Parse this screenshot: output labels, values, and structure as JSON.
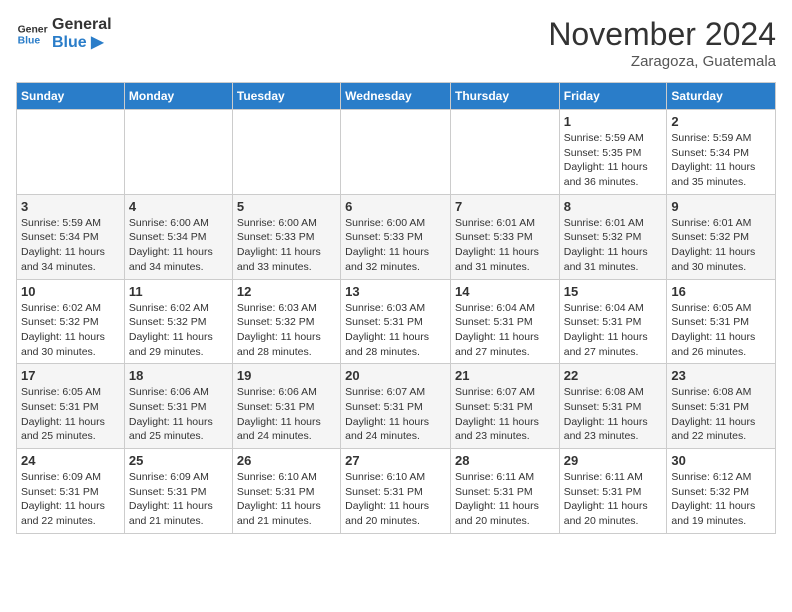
{
  "header": {
    "logo_line1": "General",
    "logo_line2": "Blue",
    "month": "November 2024",
    "location": "Zaragoza, Guatemala"
  },
  "days_of_week": [
    "Sunday",
    "Monday",
    "Tuesday",
    "Wednesday",
    "Thursday",
    "Friday",
    "Saturday"
  ],
  "weeks": [
    [
      {
        "day": "",
        "info": ""
      },
      {
        "day": "",
        "info": ""
      },
      {
        "day": "",
        "info": ""
      },
      {
        "day": "",
        "info": ""
      },
      {
        "day": "",
        "info": ""
      },
      {
        "day": "1",
        "info": "Sunrise: 5:59 AM\nSunset: 5:35 PM\nDaylight: 11 hours and 36 minutes."
      },
      {
        "day": "2",
        "info": "Sunrise: 5:59 AM\nSunset: 5:34 PM\nDaylight: 11 hours and 35 minutes."
      }
    ],
    [
      {
        "day": "3",
        "info": "Sunrise: 5:59 AM\nSunset: 5:34 PM\nDaylight: 11 hours and 34 minutes."
      },
      {
        "day": "4",
        "info": "Sunrise: 6:00 AM\nSunset: 5:34 PM\nDaylight: 11 hours and 34 minutes."
      },
      {
        "day": "5",
        "info": "Sunrise: 6:00 AM\nSunset: 5:33 PM\nDaylight: 11 hours and 33 minutes."
      },
      {
        "day": "6",
        "info": "Sunrise: 6:00 AM\nSunset: 5:33 PM\nDaylight: 11 hours and 32 minutes."
      },
      {
        "day": "7",
        "info": "Sunrise: 6:01 AM\nSunset: 5:33 PM\nDaylight: 11 hours and 31 minutes."
      },
      {
        "day": "8",
        "info": "Sunrise: 6:01 AM\nSunset: 5:32 PM\nDaylight: 11 hours and 31 minutes."
      },
      {
        "day": "9",
        "info": "Sunrise: 6:01 AM\nSunset: 5:32 PM\nDaylight: 11 hours and 30 minutes."
      }
    ],
    [
      {
        "day": "10",
        "info": "Sunrise: 6:02 AM\nSunset: 5:32 PM\nDaylight: 11 hours and 30 minutes."
      },
      {
        "day": "11",
        "info": "Sunrise: 6:02 AM\nSunset: 5:32 PM\nDaylight: 11 hours and 29 minutes."
      },
      {
        "day": "12",
        "info": "Sunrise: 6:03 AM\nSunset: 5:32 PM\nDaylight: 11 hours and 28 minutes."
      },
      {
        "day": "13",
        "info": "Sunrise: 6:03 AM\nSunset: 5:31 PM\nDaylight: 11 hours and 28 minutes."
      },
      {
        "day": "14",
        "info": "Sunrise: 6:04 AM\nSunset: 5:31 PM\nDaylight: 11 hours and 27 minutes."
      },
      {
        "day": "15",
        "info": "Sunrise: 6:04 AM\nSunset: 5:31 PM\nDaylight: 11 hours and 27 minutes."
      },
      {
        "day": "16",
        "info": "Sunrise: 6:05 AM\nSunset: 5:31 PM\nDaylight: 11 hours and 26 minutes."
      }
    ],
    [
      {
        "day": "17",
        "info": "Sunrise: 6:05 AM\nSunset: 5:31 PM\nDaylight: 11 hours and 25 minutes."
      },
      {
        "day": "18",
        "info": "Sunrise: 6:06 AM\nSunset: 5:31 PM\nDaylight: 11 hours and 25 minutes."
      },
      {
        "day": "19",
        "info": "Sunrise: 6:06 AM\nSunset: 5:31 PM\nDaylight: 11 hours and 24 minutes."
      },
      {
        "day": "20",
        "info": "Sunrise: 6:07 AM\nSunset: 5:31 PM\nDaylight: 11 hours and 24 minutes."
      },
      {
        "day": "21",
        "info": "Sunrise: 6:07 AM\nSunset: 5:31 PM\nDaylight: 11 hours and 23 minutes."
      },
      {
        "day": "22",
        "info": "Sunrise: 6:08 AM\nSunset: 5:31 PM\nDaylight: 11 hours and 23 minutes."
      },
      {
        "day": "23",
        "info": "Sunrise: 6:08 AM\nSunset: 5:31 PM\nDaylight: 11 hours and 22 minutes."
      }
    ],
    [
      {
        "day": "24",
        "info": "Sunrise: 6:09 AM\nSunset: 5:31 PM\nDaylight: 11 hours and 22 minutes."
      },
      {
        "day": "25",
        "info": "Sunrise: 6:09 AM\nSunset: 5:31 PM\nDaylight: 11 hours and 21 minutes."
      },
      {
        "day": "26",
        "info": "Sunrise: 6:10 AM\nSunset: 5:31 PM\nDaylight: 11 hours and 21 minutes."
      },
      {
        "day": "27",
        "info": "Sunrise: 6:10 AM\nSunset: 5:31 PM\nDaylight: 11 hours and 20 minutes."
      },
      {
        "day": "28",
        "info": "Sunrise: 6:11 AM\nSunset: 5:31 PM\nDaylight: 11 hours and 20 minutes."
      },
      {
        "day": "29",
        "info": "Sunrise: 6:11 AM\nSunset: 5:31 PM\nDaylight: 11 hours and 20 minutes."
      },
      {
        "day": "30",
        "info": "Sunrise: 6:12 AM\nSunset: 5:32 PM\nDaylight: 11 hours and 19 minutes."
      }
    ]
  ]
}
